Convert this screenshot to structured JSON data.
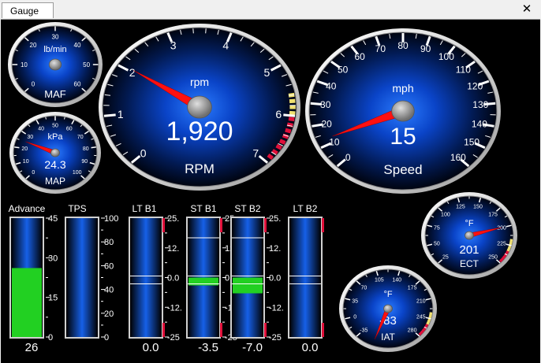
{
  "window": {
    "tab_label": "Gauge",
    "close_glyph": "✕"
  },
  "gauges": {
    "maf": {
      "label": "MAF",
      "unit": "lb/min",
      "value_text": "",
      "ticks": [
        "0",
        "10",
        "20",
        "30",
        "40",
        "50",
        "60"
      ],
      "value": 0,
      "min": 0,
      "max": 60
    },
    "map": {
      "label": "MAP",
      "unit": "kPa",
      "value_text": "24.3",
      "ticks": [
        "0",
        "10",
        "20",
        "30",
        "40",
        "50",
        "60",
        "70",
        "80",
        "90",
        "100"
      ],
      "value": 24.3,
      "min": 0,
      "max": 100
    },
    "rpm": {
      "label": "RPM",
      "unit": "rpm",
      "value_text": "1,920",
      "ticks": [
        "0",
        "1",
        "2",
        "3",
        "4",
        "5",
        "6",
        "7"
      ],
      "value": 1.92,
      "min": 0,
      "max": 7
    },
    "speed": {
      "label": "Speed",
      "unit": "mph",
      "value_text": "15",
      "ticks": [
        "0",
        "10",
        "20",
        "30",
        "40",
        "50",
        "60",
        "70",
        "80",
        "90",
        "100",
        "110",
        "120",
        "130",
        "140",
        "150",
        "160"
      ],
      "value": 15,
      "min": 0,
      "max": 160
    },
    "ect": {
      "label": "ECT",
      "unit": "°F",
      "value_text": "201",
      "ticks": [
        "25",
        "50",
        "75",
        "100",
        "125",
        "150",
        "175",
        "200",
        "225",
        "250"
      ],
      "value": 201,
      "min": 25,
      "max": 250
    },
    "iat": {
      "label": "IAT",
      "unit": "°F",
      "value_text": "-83",
      "ticks": [
        "-35",
        "0",
        "35",
        "70",
        "105",
        "140",
        "175",
        "210",
        "245",
        "280"
      ],
      "value": -83,
      "min": -35,
      "max": 280
    }
  },
  "bars": {
    "advance": {
      "label": "Advance",
      "value_text": "26",
      "ticks": [
        "45",
        "30",
        "15",
        "0"
      ]
    },
    "tps": {
      "label": "TPS",
      "value_text": "",
      "ticks": [
        "100",
        "80",
        "60",
        "40",
        "20",
        "0"
      ]
    },
    "ltb1": {
      "label": "LT B1",
      "value_text": "0.0",
      "ticks": [
        "25.",
        "12.",
        "0.0",
        "-12.",
        "-25"
      ]
    },
    "stb1": {
      "label": "ST B1",
      "value_text": "-3.5",
      "ticks": [
        "25.",
        "12.",
        "0.0",
        "-12.",
        "-25"
      ]
    },
    "stb2": {
      "label": "ST B2",
      "value_text": "-7.0",
      "ticks": [
        "25.",
        "12.",
        "0.0",
        "-12.",
        "-25"
      ]
    },
    "ltb2": {
      "label": "LT B2",
      "value_text": "0.0",
      "ticks": []
    }
  },
  "bar_levels": {
    "advance": 0.58,
    "stb1": 0.46,
    "stb2": 0.46
  },
  "colors": {
    "panel_bg": "#000000",
    "dial_center": "#1f6cff",
    "dial_edge": "#01070f",
    "needle": "#ff1010",
    "bar_fill": "#22d022",
    "redline": "#e0103a",
    "yellowline": "#f0e070"
  }
}
